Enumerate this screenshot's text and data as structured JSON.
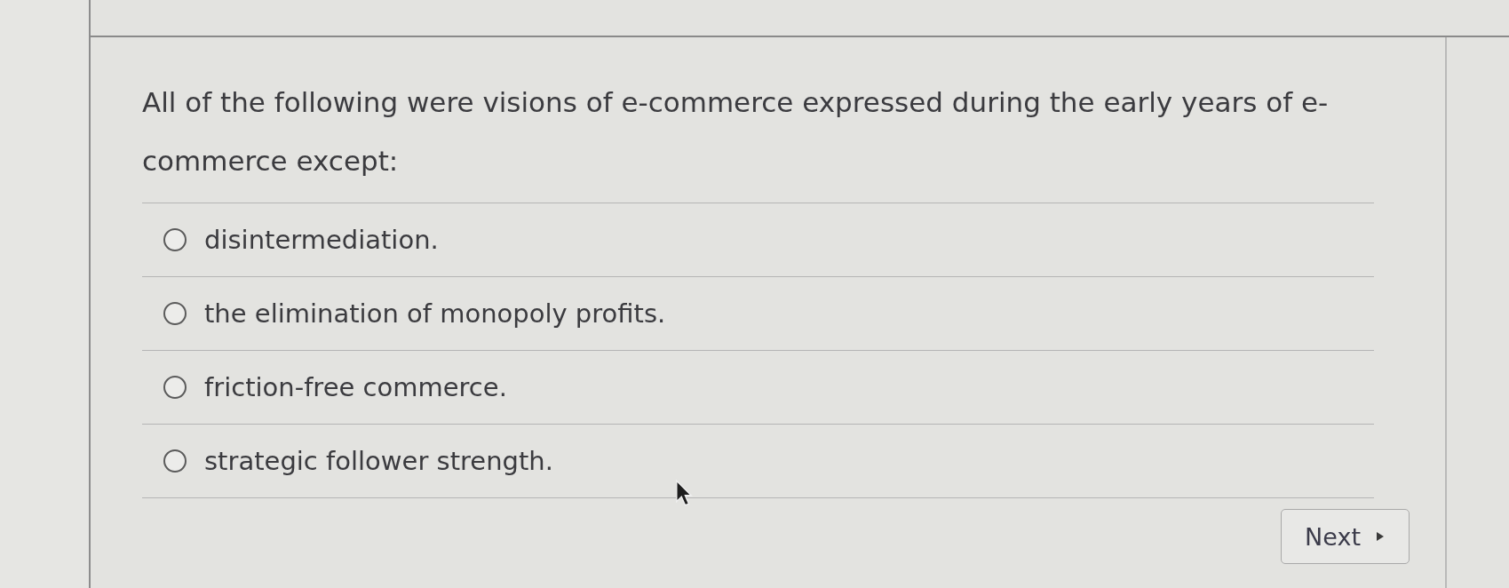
{
  "question": {
    "text": "All of the following were visions of e-commerce expressed during the early years of e-commerce except:"
  },
  "options": [
    {
      "label": "disintermediation.",
      "selected": false
    },
    {
      "label": "the elimination of monopoly profits.",
      "selected": false
    },
    {
      "label": "friction-free commerce.",
      "selected": false
    },
    {
      "label": "strategic follower strength.",
      "selected": false
    }
  ],
  "next_button": {
    "label": "Next"
  }
}
